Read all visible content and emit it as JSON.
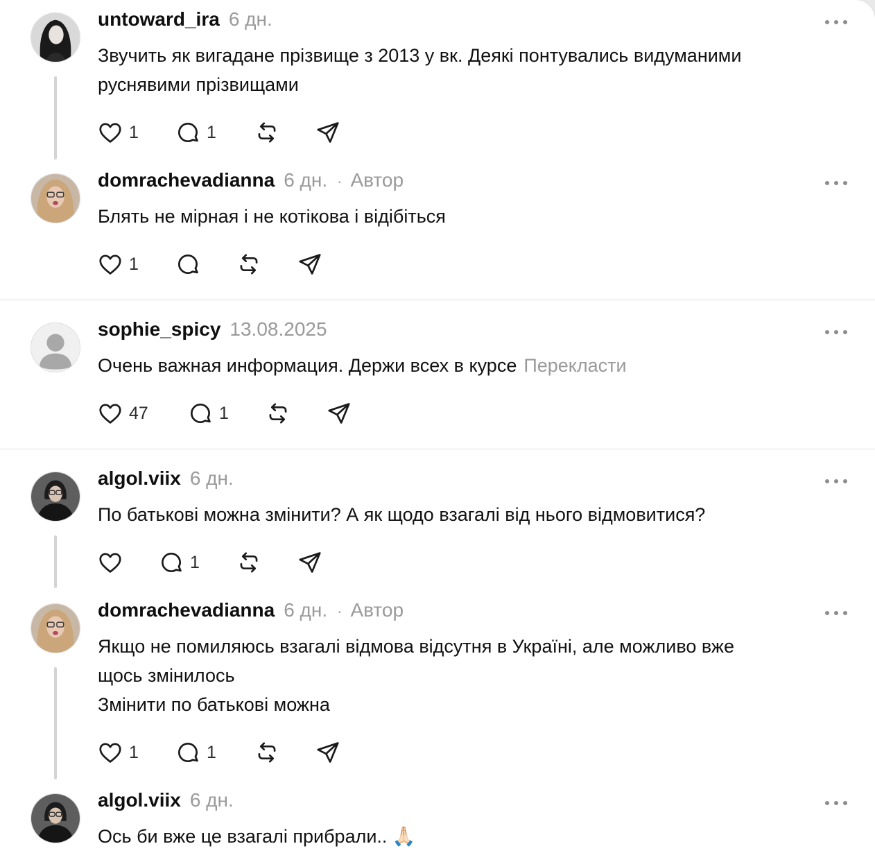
{
  "posts": [
    {
      "username": "untoward_ira",
      "time": "6 дн.",
      "text": "Звучить як вигадане прізвище з 2013 у вк. Деякі понтувались видуманими\nруснявими прізвищами",
      "likes": "1",
      "replies": "1"
    },
    {
      "username": "domrachevadianna",
      "time": "6 дн.",
      "author_label": "Автор",
      "text": "Блять не мірная і не котікова і відібіться",
      "likes": "1",
      "replies": ""
    },
    {
      "username": "sophie_spicy",
      "time": "13.08.2025",
      "text": "Очень важная информация. Держи всех в курсе",
      "translate_label": "Перекласти",
      "likes": "47",
      "replies": "1"
    },
    {
      "username": "algol.viix",
      "time": "6 дн.",
      "text": "По батькові можна змінити? А як щодо взагалі від нього відмовитися?",
      "likes": "",
      "replies": "1"
    },
    {
      "username": "domrachevadianna",
      "time": "6 дн.",
      "author_label": "Автор",
      "text": "Якщо не помиляюсь взагалі відмова відсутня в Україні, але можливо вже\nщось змінилось\nЗмінити по батькові можна",
      "likes": "1",
      "replies": "1"
    },
    {
      "username": "algol.viix",
      "time": "6 дн.",
      "text": "Ось би вже це взагалі прибрали.. 🙏🏻"
    }
  ],
  "icons": {
    "like": "heart-icon",
    "reply": "comment-icon",
    "repost": "repost-icon",
    "share": "send-icon",
    "more": "more-dots-icon"
  },
  "colors": {
    "text": "#101010",
    "muted": "#9a9a9a",
    "divider": "#dedede",
    "thread_line": "#d4d4d4"
  }
}
